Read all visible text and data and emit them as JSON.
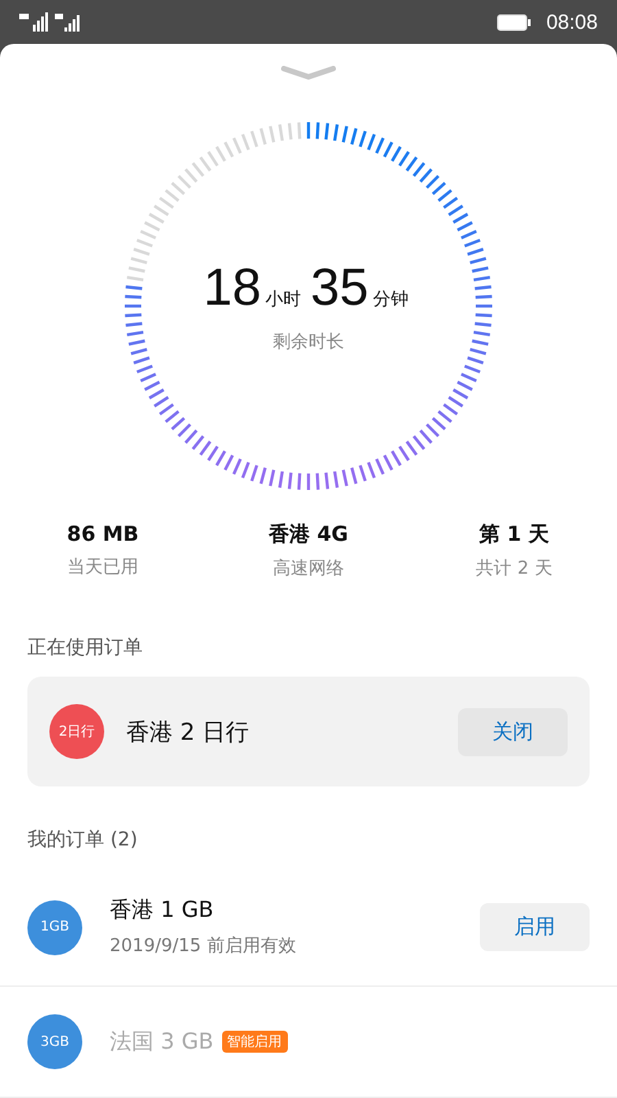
{
  "status_bar": {
    "time": "08:08"
  },
  "gauge": {
    "level": 0.77,
    "hours": "18",
    "hours_unit": "小时",
    "minutes": "35",
    "minutes_unit": "分钟",
    "caption": "剩余时长"
  },
  "stats": [
    {
      "value": "86 MB",
      "label": "当天已用"
    },
    {
      "value": "香港 4G",
      "label": "高速网络"
    },
    {
      "value": "第 1 天",
      "label": "共计 2 天"
    }
  ],
  "current_order": {
    "heading": "正在使用订单",
    "badge": "2日行",
    "name": "香港 2 日行",
    "button": "关闭",
    "color": "#ee4f54"
  },
  "my_orders": {
    "heading": "我的订单 (2)",
    "items": [
      {
        "badge": "1GB",
        "name": "香港 1 GB",
        "note": "2019/9/15 前启用有效",
        "button": "启用",
        "dimmed": false,
        "color": "#3d8fdc"
      },
      {
        "badge": "3GB",
        "name": "法国 3 GB",
        "tag": "智能启用",
        "dimmed": true,
        "color": "#3d8fdc"
      }
    ]
  }
}
